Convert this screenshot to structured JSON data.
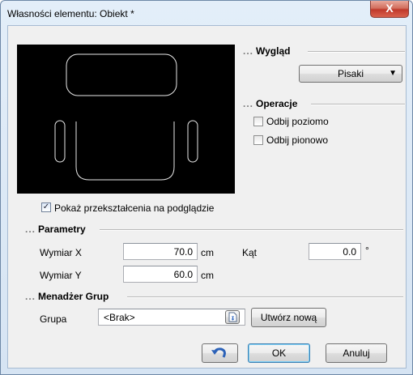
{
  "window": {
    "title": "Własności elementu: Obiekt *",
    "close_glyph": "X"
  },
  "appearance": {
    "header": "Wygląd",
    "pens_button": "Pisaki",
    "pens_arrow": "▼"
  },
  "operations": {
    "header": "Operacje",
    "flip_h": {
      "label": "Odbij poziomo",
      "checked": false
    },
    "flip_v": {
      "label": "Odbij pionowo",
      "checked": false
    }
  },
  "preview": {
    "show_transform": {
      "label": "Pokaż przekształcenia na podglądzie",
      "checked": true,
      "mark": "✓"
    }
  },
  "parameters": {
    "header": "Parametry",
    "dim_x": {
      "label": "Wymiar X",
      "value": "70.0",
      "unit": "cm"
    },
    "dim_y": {
      "label": "Wymiar Y",
      "value": "60.0",
      "unit": "cm"
    },
    "angle": {
      "label": "Kąt",
      "value": "0.0",
      "unit": "°"
    }
  },
  "groups": {
    "header": "Menadżer Grup",
    "group_label": "Grupa",
    "group_value": "<Brak>",
    "create_new": "Utwórz nową"
  },
  "footer": {
    "ok": "OK",
    "cancel": "Anuluj",
    "undo_icon": "undo-icon"
  },
  "section_dots": "..."
}
